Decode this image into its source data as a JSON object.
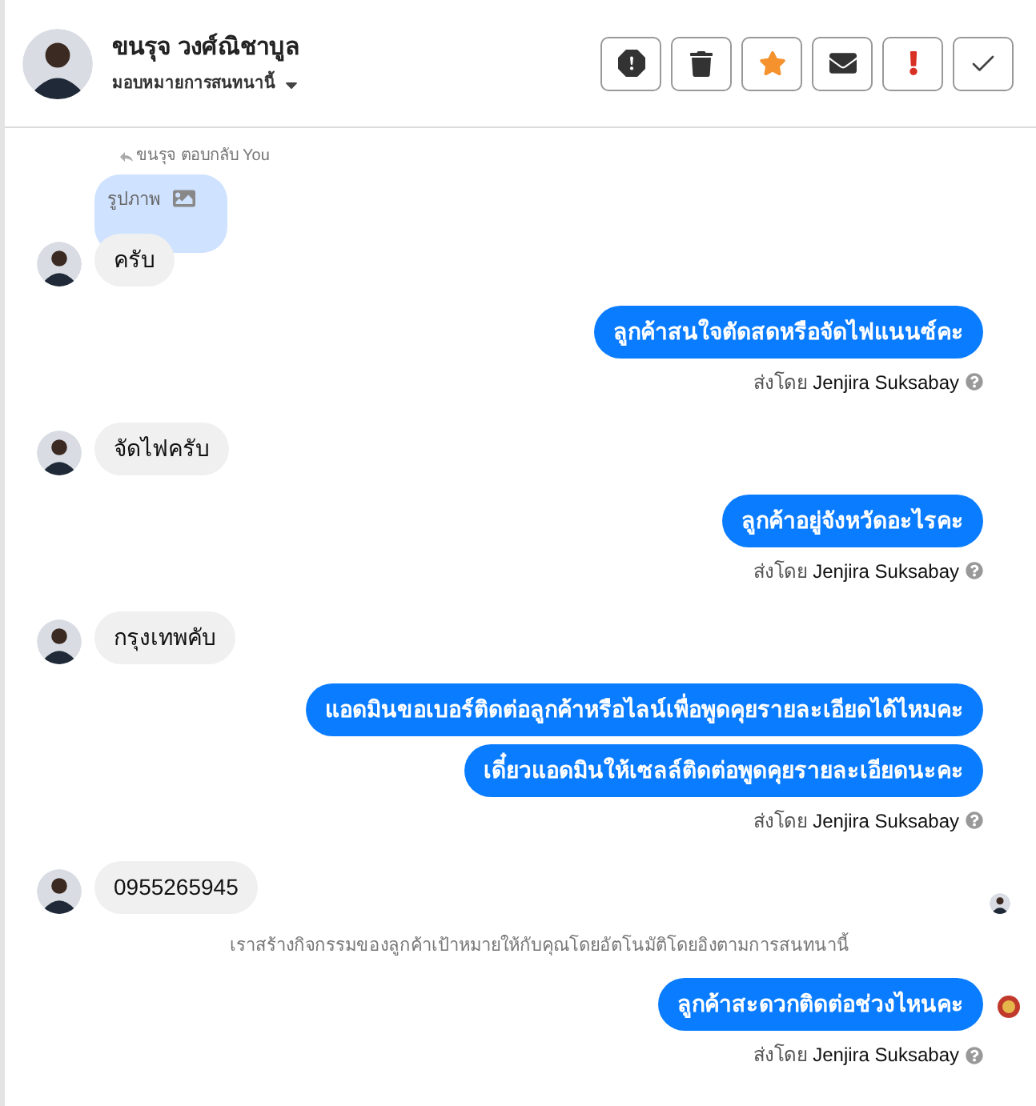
{
  "header": {
    "name": "ขนรุจ วงศ์ณิชาบูล",
    "assign_label": "มอบหมายการสนทนานี้"
  },
  "actions": [
    {
      "kind": "spam"
    },
    {
      "kind": "delete"
    },
    {
      "kind": "star"
    },
    {
      "kind": "unread"
    },
    {
      "kind": "important"
    },
    {
      "kind": "done"
    }
  ],
  "messages": [
    {
      "kind": "incoming",
      "reply_note": "ขนรุจ ตอบกลับ You",
      "attachment_label": "รูปภาพ",
      "texts": [
        "ครับ"
      ],
      "read_receipt": false
    },
    {
      "kind": "outgoing",
      "texts": [
        "ลูกค้าสนใจตัดสดหรือจัดไฟแนนซ์คะ"
      ],
      "sent_by_prefix": "ส่งโดย",
      "sent_by_name": "Jenjira Suksabay",
      "status_icon": false
    },
    {
      "kind": "incoming",
      "texts": [
        "จัดไฟครับ"
      ],
      "read_receipt": false
    },
    {
      "kind": "outgoing",
      "texts": [
        "ลูกค้าอยู่จังหวัดอะไรคะ"
      ],
      "sent_by_prefix": "ส่งโดย",
      "sent_by_name": "Jenjira Suksabay",
      "status_icon": false
    },
    {
      "kind": "incoming",
      "texts": [
        "กรุงเทพคับ"
      ],
      "read_receipt": false
    },
    {
      "kind": "outgoing",
      "texts": [
        "แอดมินขอเบอร์ติดต่อลูกค้าหรือไลน์เพื่อพูดคุยรายละเอียดได้ไหมคะ",
        "เดี๋ยวแอดมินให้เซลล์ติดต่อพูดคุยรายละเอียดนะคะ"
      ],
      "sent_by_prefix": "ส่งโดย",
      "sent_by_name": "Jenjira Suksabay",
      "status_icon": false
    },
    {
      "kind": "incoming",
      "texts": [
        "0955265945"
      ],
      "read_receipt": true
    },
    {
      "kind": "system",
      "text": "เราสร้างกิจกรรมของลูกค้าเป้าหมายให้กับคุณโดยอัตโนมัติโดยอิงตามการสนทนานี้"
    },
    {
      "kind": "outgoing",
      "texts": [
        "ลูกค้าสะดวกติดต่อช่วงไหนคะ"
      ],
      "sent_by_prefix": "ส่งโดย",
      "sent_by_name": "Jenjira Suksabay",
      "status_icon": true
    }
  ]
}
